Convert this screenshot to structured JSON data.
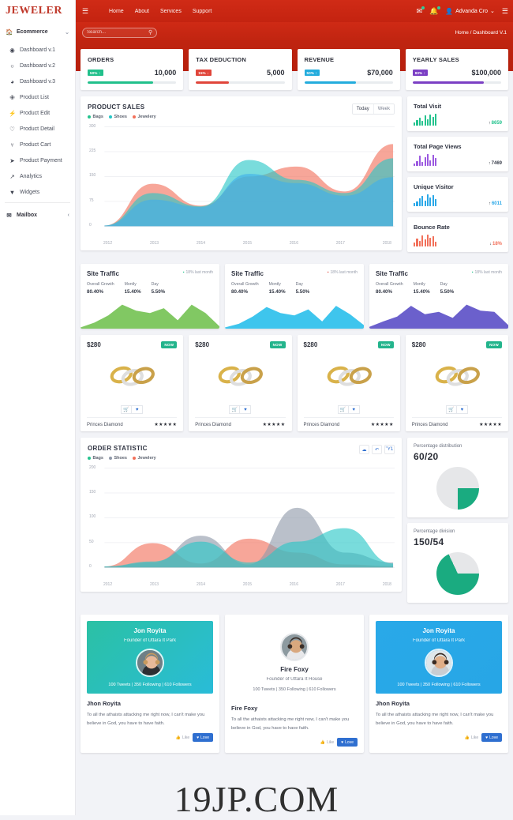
{
  "brand": {
    "name": "JEWELER"
  },
  "topbar": {
    "menu_icon": "hamburger-icon",
    "nav": [
      {
        "label": "Home"
      },
      {
        "label": "About"
      },
      {
        "label": "Services"
      },
      {
        "label": "Support"
      }
    ],
    "mail_icon": "envelope-icon",
    "bell_icon": "bell-icon",
    "user_icon": "user-icon",
    "user_name": "Advanda Cro",
    "chevron": "⌄",
    "grid_icon": "list-icon"
  },
  "subbar": {
    "search_placeholder": "Search...",
    "search_value": "",
    "search_icon": "search-icon",
    "breadcrumb": "Home / Dashboard V.1"
  },
  "sidebar": {
    "group": {
      "label": "Ecommerce",
      "icon": "home-icon",
      "chevron": "⌄"
    },
    "items": [
      {
        "label": "Dashboard v.1",
        "icon": "◉"
      },
      {
        "label": "Dashboard v.2",
        "icon": "○"
      },
      {
        "label": "Dashboard v.3",
        "icon": "◕"
      },
      {
        "label": "Product List",
        "icon": "✙"
      },
      {
        "label": "Product Edit",
        "icon": "⚡"
      },
      {
        "label": "Product Detail",
        "icon": "♡"
      },
      {
        "label": "Product Cart",
        "icon": "⑂"
      },
      {
        "label": "Product Payment",
        "icon": "➤"
      },
      {
        "label": "Analytics",
        "icon": "↗"
      },
      {
        "label": "Widgets",
        "icon": "▼"
      }
    ],
    "mailbox": {
      "label": "Mailbox",
      "icon": "✉",
      "chevron": "‹"
    }
  },
  "stats": [
    {
      "title": "ORDERS",
      "badge": "50% ↑",
      "value": "10,000",
      "percent": 74,
      "color": "#21c08b"
    },
    {
      "title": "TAX DEDUCTION",
      "badge": "15% ↓",
      "value": "5,000",
      "percent": 37,
      "color": "#e0453a"
    },
    {
      "title": "REVENUE",
      "badge": "50% ↑",
      "value": "$70,000",
      "percent": 58,
      "color": "#23acdd"
    },
    {
      "title": "YEARLY SALES",
      "badge": "80% ↑",
      "value": "$100,000",
      "percent": 80,
      "color": "#7b3fc4"
    }
  ],
  "product_sales": {
    "title": "PRODUCT SALES",
    "toggle": [
      {
        "label": "Today",
        "active": true
      },
      {
        "label": "Week",
        "active": false
      }
    ],
    "legend": [
      {
        "label": "Bags",
        "color": "#24c38e"
      },
      {
        "label": "Shoes",
        "color": "#26c6c6"
      },
      {
        "label": "Jewelery",
        "color": "#f2705a"
      }
    ]
  },
  "order_statistic": {
    "title": "ORDER STATISTIC",
    "legend": [
      {
        "label": "Bags",
        "color": "#24c38e"
      },
      {
        "label": "Shoes",
        "color": "#9099a9"
      },
      {
        "label": "Jewelery",
        "color": "#f2705a"
      }
    ],
    "tools": [
      {
        "name": "cloud-upload-icon",
        "glyph": "☁"
      },
      {
        "name": "undo-icon",
        "glyph": "↶"
      },
      {
        "name": "trash-icon",
        "glyph": "Ὕ1"
      }
    ]
  },
  "mini_stats": [
    {
      "title": "Total Visit",
      "value": "8659",
      "arrow": "↑",
      "color": "#24c38e",
      "value_color": "#24c38e"
    },
    {
      "title": "Total Page Views",
      "value": "7469",
      "arrow": "↑",
      "color": "#9b59e0",
      "value_color": "#3a3f4c"
    },
    {
      "title": "Unique Visitor",
      "value": "6011",
      "arrow": "↑",
      "color": "#2aa8e8",
      "value_color": "#2aa8e8"
    },
    {
      "title": "Bounce Rate",
      "value": "18%",
      "arrow": "↓",
      "color": "#f2705a",
      "value_color": "#f2705a"
    }
  ],
  "site_traffic": [
    {
      "title": "Site Traffic",
      "note": "18% last month",
      "note_color": "#24c38e",
      "stats": [
        {
          "label": "Overall Growth",
          "value": "80.40%"
        },
        {
          "label": "Montly",
          "value": "15.40%"
        },
        {
          "label": "Day",
          "value": "5.50%"
        }
      ],
      "color": "#76c356"
    },
    {
      "title": "Site Traffic",
      "note": "18% last month",
      "note_color": "#e0453a",
      "stats": [
        {
          "label": "Overall Growth",
          "value": "80.40%"
        },
        {
          "label": "Montly",
          "value": "15.40%"
        },
        {
          "label": "Day",
          "value": "5.50%"
        }
      ],
      "color": "#2ec0ec"
    },
    {
      "title": "Site Traffic",
      "note": "18% last month",
      "note_color": "#24c38e",
      "stats": [
        {
          "label": "Overall Growth",
          "value": "80.40%"
        },
        {
          "label": "Montly",
          "value": "15.40%"
        },
        {
          "label": "Day",
          "value": "5.50%"
        }
      ],
      "color": "#5e52c8"
    }
  ],
  "products": [
    {
      "price": "$280",
      "badge": "NOW",
      "name": "Princes Diamond",
      "stars": "★★★★★",
      "cart_icon": "cart-icon",
      "fav_icon": "heart-icon"
    },
    {
      "price": "$280",
      "badge": "NOW",
      "name": "Princes Diamond",
      "stars": "★★★★★",
      "cart_icon": "cart-icon",
      "fav_icon": "heart-icon"
    },
    {
      "price": "$280",
      "badge": "NOW",
      "name": "Princes Diamond",
      "stars": "★★★★★",
      "cart_icon": "cart-icon",
      "fav_icon": "heart-icon"
    },
    {
      "price": "$280",
      "badge": "NOW",
      "name": "Princes Diamond",
      "stars": "★★★★★",
      "cart_icon": "cart-icon",
      "fav_icon": "heart-icon"
    }
  ],
  "pies": [
    {
      "label": "Percentage distribution",
      "value": "60/20",
      "filled_pct": 25,
      "color": "#1aab80",
      "rest": "#e6e7e9"
    },
    {
      "label": "Percentage division",
      "value": "150/54",
      "filled_pct": 68,
      "color": "#1aab80",
      "rest": "#e6e7e9"
    }
  ],
  "testimonials": [
    {
      "hero_name": "Jon Royita",
      "hero_role": "Founder of Uttara It Park",
      "meta": "100 Tweets | 350 Following | 610 Followers",
      "name": "Jhon Royita",
      "text": "To all the athaists attacking me right now, I can't make you believe in God, you have to have faith.",
      "like_label": "Like",
      "love_label": "Love",
      "bg_from": "#2bc1a4",
      "bg_to": "#29bcd8",
      "style": "gradient",
      "avatar": "woman-blonde"
    },
    {
      "hero_name": "Fire Foxy",
      "hero_role": "Founder of Uttara It House",
      "meta": "100 Tweets | 350 Following | 610 Followers",
      "name": "Fire Foxy",
      "text": "To all the athaists attacking me right now, I can't make you believe in God, you have to have faith.",
      "like_label": "Like",
      "love_label": "Love",
      "bg_from": "#ffffff",
      "bg_to": "#ffffff",
      "style": "plain",
      "avatar": "man-dark"
    },
    {
      "hero_name": "Jon Royita",
      "hero_role": "Founder of Uttara It Park",
      "meta": "100 Tweets | 350 Following | 610 Followers",
      "name": "Jhon Royita",
      "text": "To all the athaists attacking me right now, I can't make you believe in God, you have to have faith.",
      "like_label": "Like",
      "love_label": "Love",
      "bg_from": "#29a9e8",
      "bg_to": "#27a6e6",
      "style": "gradient",
      "avatar": "woman-brunette"
    }
  ],
  "watermark": "19JP.COM",
  "chart_data": [
    {
      "type": "area",
      "title": "PRODUCT SALES",
      "xlabel": "",
      "ylabel": "",
      "x": [
        "2012",
        "2013",
        "2014",
        "2015",
        "2016",
        "2017",
        "2018"
      ],
      "ylim": [
        0,
        300
      ],
      "yticks": [
        0,
        75,
        150,
        225,
        300
      ],
      "grid": true,
      "legend_position": "top-left",
      "series": [
        {
          "name": "Jewelery",
          "color": "#f2705a",
          "values": [
            2,
            128,
            62,
            150,
            180,
            105,
            248
          ]
        },
        {
          "name": "Shoes",
          "color": "#26c6c6",
          "values": [
            2,
            100,
            60,
            200,
            140,
            100,
            205
          ]
        },
        {
          "name": "Bags",
          "color": "#3faeea",
          "values": [
            2,
            80,
            58,
            158,
            130,
            92,
            148
          ]
        }
      ]
    },
    {
      "type": "area",
      "title": "ORDER STATISTIC",
      "xlabel": "",
      "ylabel": "",
      "x": [
        "2012",
        "2013",
        "2014",
        "2015",
        "2016",
        "2017",
        "2018"
      ],
      "ylim": [
        0,
        200
      ],
      "yticks": [
        0,
        50,
        100,
        150,
        200
      ],
      "grid": true,
      "legend_position": "top-left",
      "series": [
        {
          "name": "Jewelery",
          "color": "#f2705a",
          "values": [
            2,
            49,
            8,
            58,
            30,
            6,
            3
          ]
        },
        {
          "name": "Shoes",
          "color": "#9099a9",
          "values": [
            2,
            10,
            64,
            6,
            120,
            30,
            10
          ]
        },
        {
          "name": "Bags",
          "color": "#26c6c6",
          "values": [
            2,
            12,
            52,
            10,
            52,
            79,
            8
          ]
        }
      ]
    },
    {
      "type": "area",
      "title": "Site Traffic 1",
      "grid": false,
      "x": [
        0,
        1,
        2,
        3,
        4,
        5,
        6,
        7,
        8,
        9,
        10
      ],
      "values": [
        2,
        10,
        22,
        40,
        30,
        26,
        34,
        14,
        40,
        26,
        4
      ],
      "ylim": [
        0,
        45
      ]
    },
    {
      "type": "area",
      "title": "Site Traffic 2",
      "grid": false,
      "x": [
        0,
        1,
        2,
        3,
        4,
        5,
        6,
        7,
        8,
        9,
        10
      ],
      "values": [
        2,
        8,
        20,
        36,
        26,
        22,
        32,
        12,
        38,
        24,
        6
      ],
      "ylim": [
        0,
        45
      ]
    },
    {
      "type": "area",
      "title": "Site Traffic 3",
      "grid": false,
      "x": [
        0,
        1,
        2,
        3,
        4,
        5,
        6,
        7,
        8,
        9,
        10
      ],
      "values": [
        3,
        12,
        20,
        38,
        24,
        28,
        18,
        40,
        30,
        28,
        6
      ],
      "ylim": [
        0,
        45
      ]
    },
    {
      "type": "pie",
      "title": "Percentage distribution",
      "labels": [
        "segment",
        "rest"
      ],
      "values": [
        25,
        75
      ],
      "colors": [
        "#1aab80",
        "#e6e7e9"
      ]
    },
    {
      "type": "pie",
      "title": "Percentage division",
      "labels": [
        "segment",
        "rest"
      ],
      "values": [
        68,
        32
      ],
      "colors": [
        "#1aab80",
        "#e6e7e9"
      ]
    },
    {
      "type": "bar",
      "title": "Total Visit sparkline",
      "values": [
        4,
        7,
        10,
        6,
        13,
        8,
        14,
        11,
        15
      ],
      "color": "#24c38e"
    },
    {
      "type": "bar",
      "title": "Total Page Views sparkline",
      "values": [
        3,
        6,
        12,
        5,
        10,
        14,
        7,
        13,
        9
      ],
      "color": "#9b59e0"
    },
    {
      "type": "bar",
      "title": "Unique Visitor sparkline",
      "values": [
        4,
        6,
        9,
        12,
        7,
        14,
        10,
        13,
        8
      ],
      "color": "#2aa8e8"
    },
    {
      "type": "bar",
      "title": "Bounce Rate sparkline",
      "values": [
        5,
        9,
        7,
        13,
        8,
        14,
        10,
        12,
        6
      ],
      "color": "#f2705a"
    }
  ]
}
